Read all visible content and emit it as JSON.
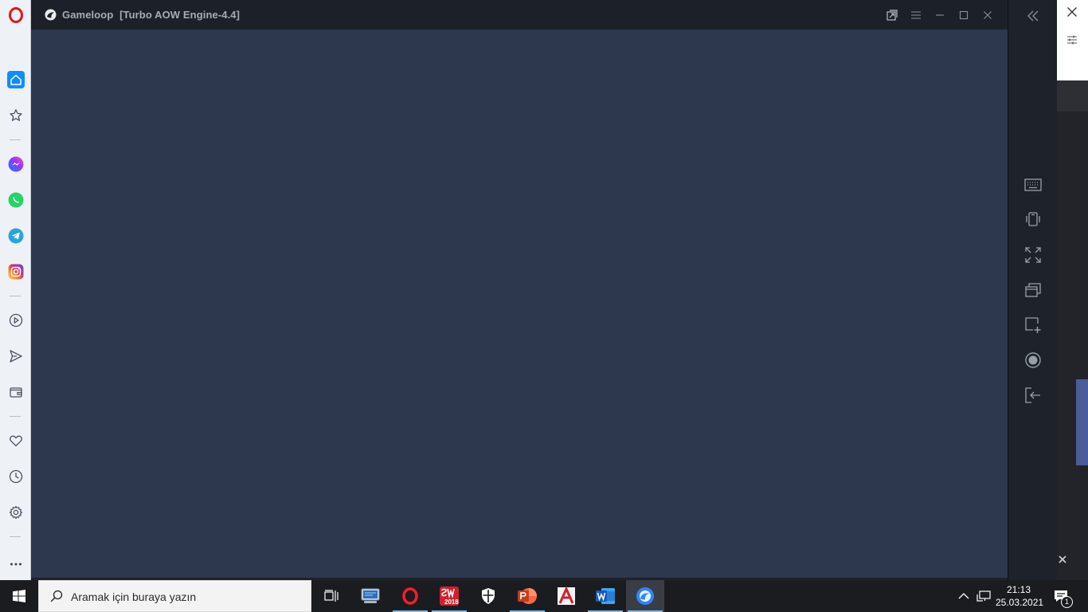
{
  "gameloop": {
    "title": "Gameloop",
    "engine": "[Turbo AOW Engine-4.4]"
  },
  "icons": {
    "opera_logo": "opera-logo-icon",
    "home": "home-icon",
    "speed_dial": "star-icon",
    "messenger": "messenger-icon",
    "whatsapp": "whatsapp-icon",
    "telegram": "telegram-icon",
    "instagram": "instagram-icon",
    "player": "play-circle-icon",
    "flow": "send-icon",
    "wallet": "wallet-icon",
    "bookmarks": "heart-icon",
    "history": "clock-icon",
    "settings": "gear-icon",
    "more": "more-dots-icon"
  },
  "taskbar": {
    "search_placeholder": "Aramak için buraya yazın",
    "time": "21:13",
    "date": "25.03.2021",
    "notification_count": "1",
    "sw_badge": "2018"
  },
  "colors": {
    "content_bg": "#2d374d",
    "sidebar_accent": "#1e90ff",
    "scroll_thumb": "#4b5c9a"
  }
}
